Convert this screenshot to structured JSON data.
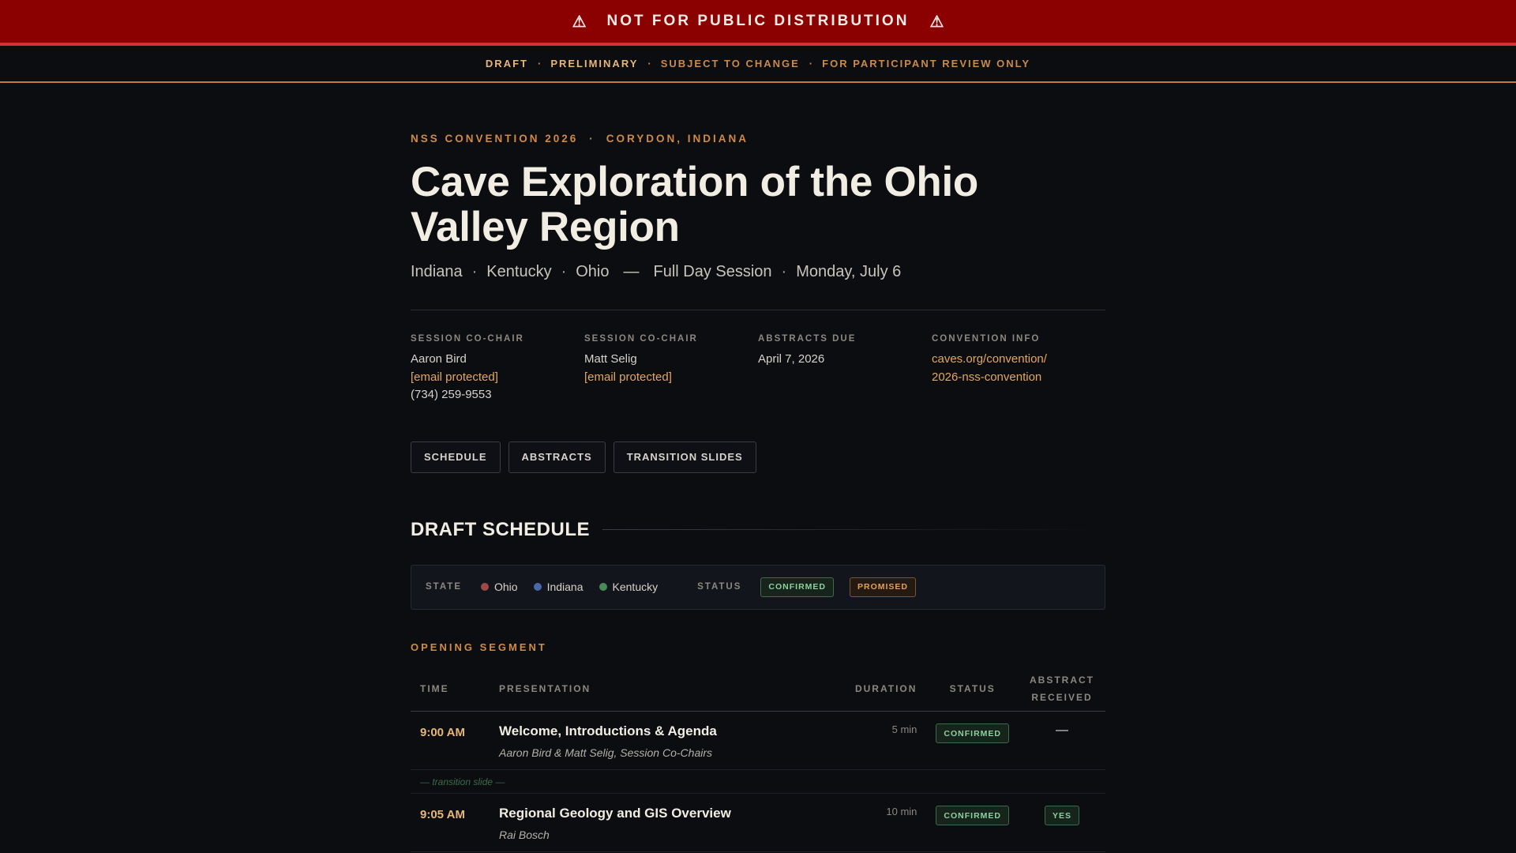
{
  "banner": {
    "icon_left": "warning-icon",
    "icon_right": "warning-icon",
    "text": "NOT FOR PUBLIC DISTRIBUTION",
    "warn_glyph": "⚠"
  },
  "subbar": {
    "items": [
      "DRAFT",
      "PRELIMINARY",
      "SUBJECT TO CHANGE",
      "FOR PARTICIPANT REVIEW ONLY"
    ],
    "separator": "·"
  },
  "header": {
    "eyebrow_left": "NSS CONVENTION 2026",
    "eyebrow_sep": "·",
    "eyebrow_right": "CORYDON, INDIANA",
    "title": "Cave Exploration of the Ohio Valley Region",
    "subtitle": {
      "states": [
        "Indiana",
        "Kentucky",
        "Ohio"
      ],
      "dot": "·",
      "dash": "—",
      "session": "Full Day Session",
      "date": "Monday, July 6"
    }
  },
  "meta": {
    "cochair1": {
      "label": "SESSION CO-CHAIR",
      "name": "Aaron Bird",
      "email": "[email protected]",
      "phone": "(734) 259-9553"
    },
    "cochair2": {
      "label": "SESSION CO-CHAIR",
      "name": "Matt Selig",
      "email": "[email protected]"
    },
    "abstracts": {
      "label": "ABSTRACTS DUE",
      "value": "April 7, 2026"
    },
    "convention": {
      "label": "CONVENTION INFO",
      "link_line1": "caves.org/convention/",
      "link_line2": "2026-nss-convention"
    }
  },
  "tabs": [
    "SCHEDULE",
    "ABSTRACTS",
    "TRANSITION SLIDES"
  ],
  "schedule": {
    "heading": "DRAFT SCHEDULE",
    "legend": {
      "state_label": "STATE",
      "states": [
        {
          "name": "Ohio",
          "color": "#a04848"
        },
        {
          "name": "Indiana",
          "color": "#4a68a8"
        },
        {
          "name": "Kentucky",
          "color": "#4a8a58"
        }
      ],
      "status_label": "STATUS",
      "confirmed": "CONFIRMED",
      "promised": "PROMISED"
    },
    "segment_title": "OPENING SEGMENT",
    "columns": {
      "time": "TIME",
      "presentation": "PRESENTATION",
      "duration": "DURATION",
      "status": "STATUS",
      "abstract_line1": "ABSTRACT",
      "abstract_line2": "RECEIVED"
    },
    "rows": [
      {
        "time": "9:00 AM",
        "title": "Welcome, Introductions & Agenda",
        "speaker": "Aaron Bird & Matt Selig, Session Co-Chairs",
        "duration": "5 min",
        "status": "CONFIRMED",
        "abstract": "—"
      },
      {
        "time": "9:05 AM",
        "title": "Regional Geology and GIS Overview",
        "speaker": "Rai Bosch",
        "duration": "10 min",
        "status": "CONFIRMED",
        "abstract": "YES"
      }
    ],
    "transition_text": "— transition slide —"
  },
  "colors": {
    "banner_bg": "#8b0000",
    "accent": "#d08a43",
    "background": "#0b0d11"
  }
}
